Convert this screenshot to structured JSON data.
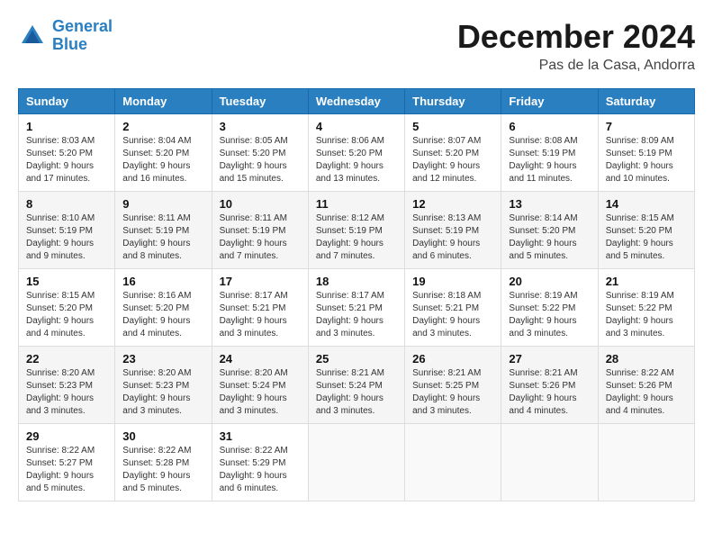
{
  "logo": {
    "line1": "General",
    "line2": "Blue"
  },
  "title": "December 2024",
  "subtitle": "Pas de la Casa, Andorra",
  "columns": [
    "Sunday",
    "Monday",
    "Tuesday",
    "Wednesday",
    "Thursday",
    "Friday",
    "Saturday"
  ],
  "weeks": [
    [
      {
        "day": "1",
        "sunrise": "Sunrise: 8:03 AM",
        "sunset": "Sunset: 5:20 PM",
        "daylight": "Daylight: 9 hours and 17 minutes."
      },
      {
        "day": "2",
        "sunrise": "Sunrise: 8:04 AM",
        "sunset": "Sunset: 5:20 PM",
        "daylight": "Daylight: 9 hours and 16 minutes."
      },
      {
        "day": "3",
        "sunrise": "Sunrise: 8:05 AM",
        "sunset": "Sunset: 5:20 PM",
        "daylight": "Daylight: 9 hours and 15 minutes."
      },
      {
        "day": "4",
        "sunrise": "Sunrise: 8:06 AM",
        "sunset": "Sunset: 5:20 PM",
        "daylight": "Daylight: 9 hours and 13 minutes."
      },
      {
        "day": "5",
        "sunrise": "Sunrise: 8:07 AM",
        "sunset": "Sunset: 5:20 PM",
        "daylight": "Daylight: 9 hours and 12 minutes."
      },
      {
        "day": "6",
        "sunrise": "Sunrise: 8:08 AM",
        "sunset": "Sunset: 5:19 PM",
        "daylight": "Daylight: 9 hours and 11 minutes."
      },
      {
        "day": "7",
        "sunrise": "Sunrise: 8:09 AM",
        "sunset": "Sunset: 5:19 PM",
        "daylight": "Daylight: 9 hours and 10 minutes."
      }
    ],
    [
      {
        "day": "8",
        "sunrise": "Sunrise: 8:10 AM",
        "sunset": "Sunset: 5:19 PM",
        "daylight": "Daylight: 9 hours and 9 minutes."
      },
      {
        "day": "9",
        "sunrise": "Sunrise: 8:11 AM",
        "sunset": "Sunset: 5:19 PM",
        "daylight": "Daylight: 9 hours and 8 minutes."
      },
      {
        "day": "10",
        "sunrise": "Sunrise: 8:11 AM",
        "sunset": "Sunset: 5:19 PM",
        "daylight": "Daylight: 9 hours and 7 minutes."
      },
      {
        "day": "11",
        "sunrise": "Sunrise: 8:12 AM",
        "sunset": "Sunset: 5:19 PM",
        "daylight": "Daylight: 9 hours and 7 minutes."
      },
      {
        "day": "12",
        "sunrise": "Sunrise: 8:13 AM",
        "sunset": "Sunset: 5:19 PM",
        "daylight": "Daylight: 9 hours and 6 minutes."
      },
      {
        "day": "13",
        "sunrise": "Sunrise: 8:14 AM",
        "sunset": "Sunset: 5:20 PM",
        "daylight": "Daylight: 9 hours and 5 minutes."
      },
      {
        "day": "14",
        "sunrise": "Sunrise: 8:15 AM",
        "sunset": "Sunset: 5:20 PM",
        "daylight": "Daylight: 9 hours and 5 minutes."
      }
    ],
    [
      {
        "day": "15",
        "sunrise": "Sunrise: 8:15 AM",
        "sunset": "Sunset: 5:20 PM",
        "daylight": "Daylight: 9 hours and 4 minutes."
      },
      {
        "day": "16",
        "sunrise": "Sunrise: 8:16 AM",
        "sunset": "Sunset: 5:20 PM",
        "daylight": "Daylight: 9 hours and 4 minutes."
      },
      {
        "day": "17",
        "sunrise": "Sunrise: 8:17 AM",
        "sunset": "Sunset: 5:21 PM",
        "daylight": "Daylight: 9 hours and 3 minutes."
      },
      {
        "day": "18",
        "sunrise": "Sunrise: 8:17 AM",
        "sunset": "Sunset: 5:21 PM",
        "daylight": "Daylight: 9 hours and 3 minutes."
      },
      {
        "day": "19",
        "sunrise": "Sunrise: 8:18 AM",
        "sunset": "Sunset: 5:21 PM",
        "daylight": "Daylight: 9 hours and 3 minutes."
      },
      {
        "day": "20",
        "sunrise": "Sunrise: 8:19 AM",
        "sunset": "Sunset: 5:22 PM",
        "daylight": "Daylight: 9 hours and 3 minutes."
      },
      {
        "day": "21",
        "sunrise": "Sunrise: 8:19 AM",
        "sunset": "Sunset: 5:22 PM",
        "daylight": "Daylight: 9 hours and 3 minutes."
      }
    ],
    [
      {
        "day": "22",
        "sunrise": "Sunrise: 8:20 AM",
        "sunset": "Sunset: 5:23 PM",
        "daylight": "Daylight: 9 hours and 3 minutes."
      },
      {
        "day": "23",
        "sunrise": "Sunrise: 8:20 AM",
        "sunset": "Sunset: 5:23 PM",
        "daylight": "Daylight: 9 hours and 3 minutes."
      },
      {
        "day": "24",
        "sunrise": "Sunrise: 8:20 AM",
        "sunset": "Sunset: 5:24 PM",
        "daylight": "Daylight: 9 hours and 3 minutes."
      },
      {
        "day": "25",
        "sunrise": "Sunrise: 8:21 AM",
        "sunset": "Sunset: 5:24 PM",
        "daylight": "Daylight: 9 hours and 3 minutes."
      },
      {
        "day": "26",
        "sunrise": "Sunrise: 8:21 AM",
        "sunset": "Sunset: 5:25 PM",
        "daylight": "Daylight: 9 hours and 3 minutes."
      },
      {
        "day": "27",
        "sunrise": "Sunrise: 8:21 AM",
        "sunset": "Sunset: 5:26 PM",
        "daylight": "Daylight: 9 hours and 4 minutes."
      },
      {
        "day": "28",
        "sunrise": "Sunrise: 8:22 AM",
        "sunset": "Sunset: 5:26 PM",
        "daylight": "Daylight: 9 hours and 4 minutes."
      }
    ],
    [
      {
        "day": "29",
        "sunrise": "Sunrise: 8:22 AM",
        "sunset": "Sunset: 5:27 PM",
        "daylight": "Daylight: 9 hours and 5 minutes."
      },
      {
        "day": "30",
        "sunrise": "Sunrise: 8:22 AM",
        "sunset": "Sunset: 5:28 PM",
        "daylight": "Daylight: 9 hours and 5 minutes."
      },
      {
        "day": "31",
        "sunrise": "Sunrise: 8:22 AM",
        "sunset": "Sunset: 5:29 PM",
        "daylight": "Daylight: 9 hours and 6 minutes."
      },
      null,
      null,
      null,
      null
    ]
  ]
}
